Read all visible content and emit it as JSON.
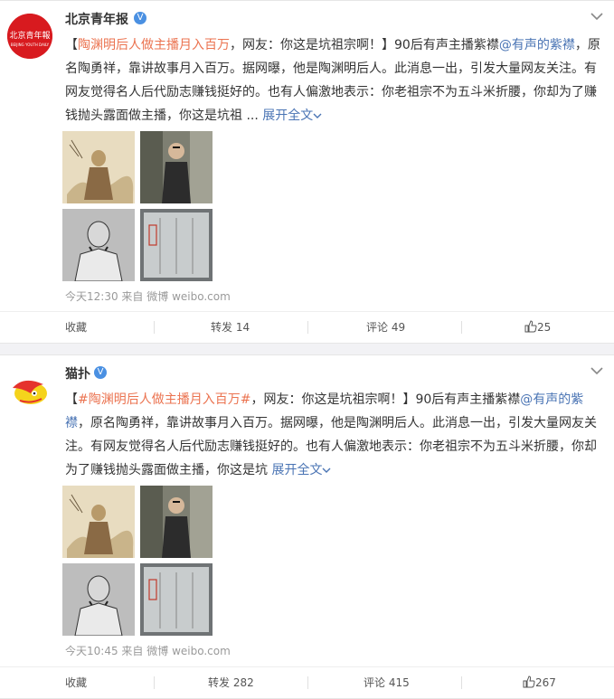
{
  "posts": [
    {
      "author": "北京青年报",
      "verified_badge": "V",
      "avatar_text": "北京青年报",
      "text_parts": {
        "prefix": "【",
        "topic": "陶渊明后人做主播月入百万",
        "after_topic": "，网友：你这是坑祖宗啊！】90后有声主播紫襟",
        "mention": "@有声的紫襟",
        "body": "，原名陶勇祥，靠讲故事月入百万。据网曝，他是陶渊明后人。此消息一出，引发大量网友关注。有网友觉得名人后代励志赚钱挺好的。也有人偏激地表示：你老祖宗不为五斗米折腰，你却为了赚钱抛头露面做主播，你这是坑祖",
        "ellipsis": " ... ",
        "expand": "展开全文"
      },
      "time": "今天12:30",
      "source_prefix": "来自",
      "source": "微博 weibo.com",
      "actions": {
        "favorite": "收藏",
        "repost": "转发 14",
        "comment": "评论 49",
        "like": "25"
      }
    },
    {
      "author": "猫扑",
      "verified_badge": "V",
      "text_parts": {
        "prefix": "【",
        "topic": "#陶渊明后人做主播月入百万#",
        "after_topic": "，网友：你这是坑祖宗啊！】90后有声主播紫襟",
        "mention": "@有声的紫襟",
        "body": "，原名陶勇祥，靠讲故事月入百万。据网曝，他是陶渊明后人。此消息一出，引发大量网友关注。有网友觉得名人后代励志赚钱挺好的。也有人偏激地表示：你老祖宗不为五斗米折腰，你却为了赚钱抛头露面做主播，你这是坑",
        "ellipsis": " ",
        "expand": "展开全文"
      },
      "time": "今天10:45",
      "source_prefix": "来自",
      "source": "微博 weibo.com",
      "actions": {
        "favorite": "收藏",
        "repost": "转发 282",
        "comment": "评论 415",
        "like": "267"
      }
    }
  ],
  "colors": {
    "topic_link": "#eb7350",
    "mention_link": "#4a74b4",
    "verified": "#4a90e2"
  }
}
